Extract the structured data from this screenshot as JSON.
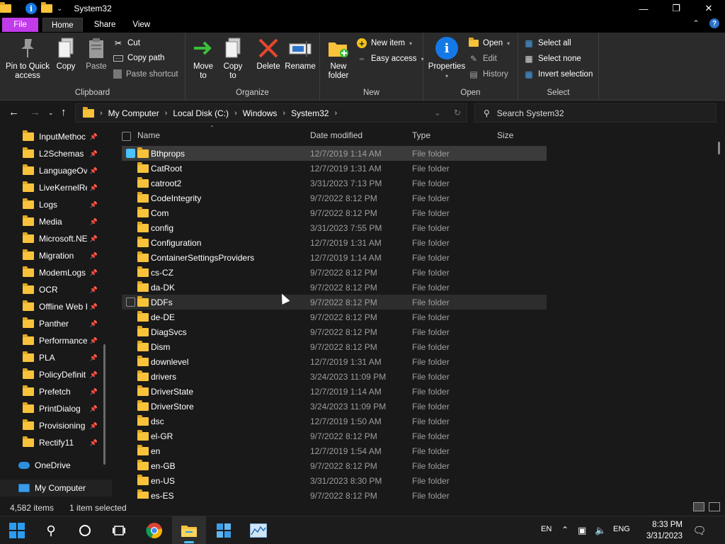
{
  "window": {
    "title": "System32"
  },
  "tabs": {
    "file": "File",
    "home": "Home",
    "share": "Share",
    "view": "View"
  },
  "ribbon": {
    "clipboard": {
      "label": "Clipboard",
      "pin_line1": "Pin to Quick",
      "pin_line2": "access",
      "copy": "Copy",
      "paste": "Paste",
      "cut": "Cut",
      "copy_path": "Copy path",
      "paste_shortcut": "Paste shortcut"
    },
    "organize": {
      "label": "Organize",
      "move_to_1": "Move",
      "move_to_2": "to",
      "copy_to_1": "Copy",
      "copy_to_2": "to",
      "delete": "Delete",
      "rename": "Rename"
    },
    "new": {
      "label": "New",
      "new_folder_1": "New",
      "new_folder_2": "folder",
      "new_item": "New item",
      "easy_access": "Easy access"
    },
    "open": {
      "label": "Open",
      "properties": "Properties",
      "open": "Open",
      "edit": "Edit",
      "history": "History"
    },
    "select": {
      "label": "Select",
      "select_all": "Select all",
      "select_none": "Select none",
      "invert": "Invert selection"
    }
  },
  "address": {
    "crumbs": [
      "My Computer",
      "Local Disk (C:)",
      "Windows",
      "System32"
    ],
    "search_placeholder": "Search System32"
  },
  "nav": {
    "items": [
      {
        "label": "InputMethoc",
        "pinned": true
      },
      {
        "label": "L2Schemas",
        "pinned": true
      },
      {
        "label": "LanguageOv",
        "pinned": true
      },
      {
        "label": "LiveKernelRe",
        "pinned": true
      },
      {
        "label": "Logs",
        "pinned": true
      },
      {
        "label": "Media",
        "pinned": true
      },
      {
        "label": "Microsoft.NE",
        "pinned": true
      },
      {
        "label": "Migration",
        "pinned": true
      },
      {
        "label": "ModemLogs",
        "pinned": true
      },
      {
        "label": "OCR",
        "pinned": true
      },
      {
        "label": "Offline Web I",
        "pinned": true
      },
      {
        "label": "Panther",
        "pinned": true
      },
      {
        "label": "Performance",
        "pinned": true
      },
      {
        "label": "PLA",
        "pinned": true
      },
      {
        "label": "PolicyDefinit",
        "pinned": true
      },
      {
        "label": "Prefetch",
        "pinned": true
      },
      {
        "label": "PrintDialog",
        "pinned": true
      },
      {
        "label": "Provisioning",
        "pinned": true
      },
      {
        "label": "Rectify11",
        "pinned": true
      }
    ],
    "onedrive": "OneDrive",
    "mycomputer": "My Computer"
  },
  "columns": {
    "name": "Name",
    "date": "Date modified",
    "type": "Type",
    "size": "Size"
  },
  "files": [
    {
      "name": "Bthprops",
      "date": "12/7/2019 1:14 AM",
      "type": "File folder",
      "state": "selected"
    },
    {
      "name": "CatRoot",
      "date": "12/7/2019 1:31 AM",
      "type": "File folder"
    },
    {
      "name": "catroot2",
      "date": "3/31/2023 7:13 PM",
      "type": "File folder"
    },
    {
      "name": "CodeIntegrity",
      "date": "9/7/2022 8:12 PM",
      "type": "File folder"
    },
    {
      "name": "Com",
      "date": "9/7/2022 8:12 PM",
      "type": "File folder"
    },
    {
      "name": "config",
      "date": "3/31/2023 7:55 PM",
      "type": "File folder"
    },
    {
      "name": "Configuration",
      "date": "12/7/2019 1:31 AM",
      "type": "File folder"
    },
    {
      "name": "ContainerSettingsProviders",
      "date": "12/7/2019 1:14 AM",
      "type": "File folder"
    },
    {
      "name": "cs-CZ",
      "date": "9/7/2022 8:12 PM",
      "type": "File folder"
    },
    {
      "name": "da-DK",
      "date": "9/7/2022 8:12 PM",
      "type": "File folder"
    },
    {
      "name": "DDFs",
      "date": "9/7/2022 8:12 PM",
      "type": "File folder",
      "state": "hover"
    },
    {
      "name": "de-DE",
      "date": "9/7/2022 8:12 PM",
      "type": "File folder"
    },
    {
      "name": "DiagSvcs",
      "date": "9/7/2022 8:12 PM",
      "type": "File folder"
    },
    {
      "name": "Dism",
      "date": "9/7/2022 8:12 PM",
      "type": "File folder"
    },
    {
      "name": "downlevel",
      "date": "12/7/2019 1:31 AM",
      "type": "File folder"
    },
    {
      "name": "drivers",
      "date": "3/24/2023 11:09 PM",
      "type": "File folder"
    },
    {
      "name": "DriverState",
      "date": "12/7/2019 1:14 AM",
      "type": "File folder"
    },
    {
      "name": "DriverStore",
      "date": "3/24/2023 11:09 PM",
      "type": "File folder"
    },
    {
      "name": "dsc",
      "date": "12/7/2019 1:50 AM",
      "type": "File folder"
    },
    {
      "name": "el-GR",
      "date": "9/7/2022 8:12 PM",
      "type": "File folder"
    },
    {
      "name": "en",
      "date": "12/7/2019 1:54 AM",
      "type": "File folder"
    },
    {
      "name": "en-GB",
      "date": "9/7/2022 8:12 PM",
      "type": "File folder"
    },
    {
      "name": "en-US",
      "date": "3/31/2023 8:30 PM",
      "type": "File folder"
    },
    {
      "name": "es-ES",
      "date": "9/7/2022 8:12 PM",
      "type": "File folder"
    }
  ],
  "status": {
    "count": "4,582 items",
    "selected": "1 item selected"
  },
  "taskbar": {
    "lang": "EN",
    "ime": "ENG",
    "time": "8:33 PM",
    "date": "3/31/2023"
  },
  "colors": {
    "accent": "#4cc2ff",
    "file_tab": "#c13bea",
    "folder": "#f8c33b"
  }
}
